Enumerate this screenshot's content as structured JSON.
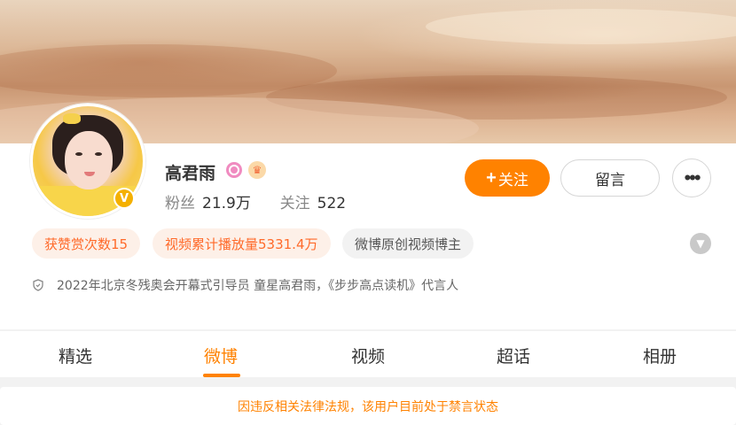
{
  "profile": {
    "name": "高君雨",
    "verified_mark": "V",
    "fans_label": "粉丝",
    "fans_count": "21.9万",
    "following_label": "关注",
    "following_count": "522"
  },
  "actions": {
    "follow_plus": "+",
    "follow_label": "关注",
    "message_label": "留言",
    "more_label": "•••"
  },
  "tags": [
    "获赞赏次数15",
    "视频累计播放量5331.4万",
    "微博原创视频博主"
  ],
  "description": "2022年北京冬残奥会开幕式引导员 童星高君雨，《步步高点读机》代言人",
  "tabs": [
    "精选",
    "微博",
    "视频",
    "超话",
    "相册"
  ],
  "active_tab": "微博",
  "notice": "因违反相关法律法规，该用户目前处于禁言状态",
  "icons": {
    "badge_pink": "pink-circle-icon",
    "badge_crown": "crown-icon",
    "expand": "chevron-down-icon",
    "description": "shield-icon",
    "more": "more-dots-icon"
  },
  "colors": {
    "accent": "#ff8200",
    "tag_orange_bg": "#fdf0e8",
    "tag_orange_text": "#ff6a2a",
    "notice_text": "#ff8200"
  }
}
